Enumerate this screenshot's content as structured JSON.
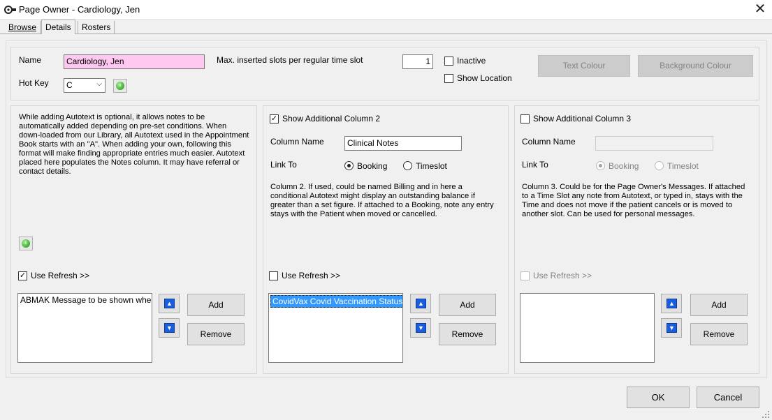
{
  "window": {
    "title": "Page Owner - Cardiology, Jen",
    "close_glyph": "✕"
  },
  "tabs": [
    {
      "label": "Browse",
      "active": false
    },
    {
      "label": "Details",
      "active": true
    },
    {
      "label": "Rosters",
      "active": false
    }
  ],
  "details": {
    "name_label": "Name",
    "name_value": "Cardiology, Jen",
    "hotkey_label": "Hot Key",
    "hotkey_value": "C",
    "max_slots_label": "Max. inserted slots per regular time slot",
    "max_slots_value": "1",
    "inactive_label": "Inactive",
    "inactive_checked": false,
    "show_location_label": "Show Location",
    "show_location_checked": false,
    "text_colour_label": "Text Colour",
    "background_colour_label": "Background Colour",
    "name_field_color": "#ffc8f0"
  },
  "column1": {
    "description": "While adding Autotext is optional, it allows notes to be automatically added depending on pre-set conditions.  When down-loaded from our Library, all Autotext used in the Appointment Book starts with an \"A\". When adding your own, following this format will make finding appropriate entries much easier. Autotext placed here populates the Notes column. It may have referral or contact details.",
    "use_refresh_label": "Use Refresh >>",
    "use_refresh_checked": true,
    "list_items": [
      "ABMAK Message to be shown when r"
    ],
    "add_label": "Add",
    "remove_label": "Remove"
  },
  "column2": {
    "show_label": "Show Additional Column 2",
    "show_checked": true,
    "column_name_label": "Column Name",
    "column_name_value": "Clinical Notes",
    "link_to_label": "Link To",
    "booking_label": "Booking",
    "timeslot_label": "Timeslot",
    "link_selected": "Booking",
    "description": "Column 2.  If used, could be named Billing and in here a conditional Autotext might display an outstanding balance if greater than a set figure.  If attached to a Booking, note any entry stays with the Patient when moved or cancelled.",
    "use_refresh_label": "Use Refresh >>",
    "use_refresh_checked": false,
    "list_items": [
      "CovidVax Covid Vaccination Status"
    ],
    "add_label": "Add",
    "remove_label": "Remove",
    "selected_item_color": "#3399ff"
  },
  "column3": {
    "show_label": "Show Additional Column 3",
    "show_checked": false,
    "column_name_label": "Column Name",
    "column_name_value": "",
    "link_to_label": "Link To",
    "booking_label": "Booking",
    "timeslot_label": "Timeslot",
    "link_selected": "Booking",
    "description": "Column 3. Could be for the Page Owner's Messages.  If attached to a Time Slot any note from Autotext, or typed in, stays with the Time and does not move if the patient cancels or is moved to another slot. Can be used for personal messages.",
    "use_refresh_label": "Use Refresh >>",
    "use_refresh_checked": false,
    "list_items": [],
    "add_label": "Add",
    "remove_label": "Remove"
  },
  "footer": {
    "ok_label": "OK",
    "cancel_label": "Cancel"
  }
}
